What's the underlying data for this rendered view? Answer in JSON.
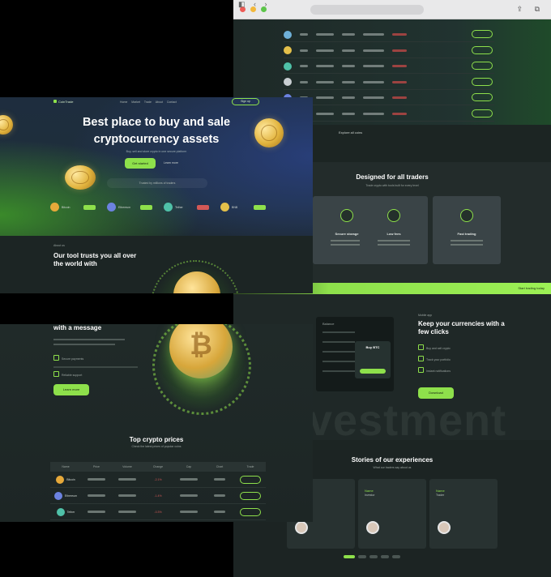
{
  "colors": {
    "accent": "#8ee04b",
    "bg_dark": "#1c2523",
    "negative": "#d35856"
  },
  "browser": {
    "traffic_lights": [
      "#ee5b56",
      "#f2b83b",
      "#5dc54a"
    ],
    "icons": [
      "back-icon",
      "forward-icon",
      "reload-icon",
      "share-icon",
      "tabs-icon"
    ]
  },
  "market": {
    "row_icons": [
      "#6fb0d8",
      "#e4c04a",
      "#4fc1a8",
      "#c9ced2",
      "#6c82e0",
      "#8e6fd8"
    ],
    "see_all": "Explore all coins"
  },
  "designed": {
    "title": "Designed for all traders",
    "subtitle": "Trade crypto with tools built for every level",
    "cards": [
      {
        "title": "Secure storage"
      },
      {
        "title": "Low fees"
      },
      {
        "title": "Fast trading"
      }
    ]
  },
  "banner": {
    "text": "Start trading today"
  },
  "keep": {
    "eyebrow": "Mobile app",
    "title": "Keep your currencies with a few clicks",
    "items": [
      "Buy and sell crypto",
      "Track your portfolio",
      "Instant notifications"
    ],
    "cta": "Download",
    "phone_header": "Balance",
    "popup_title": "Buy BTC"
  },
  "watermark": "vestment",
  "stories": {
    "title": "Stories of our experiences",
    "subtitle": "What our traders say about us",
    "cards": [
      {
        "name": "Name",
        "role": "Trader"
      },
      {
        "name": "Name",
        "role": "Investor"
      },
      {
        "name": "Name",
        "role": "Trader"
      }
    ]
  },
  "hero": {
    "nav_logo": "CoinTrade",
    "nav_links": "Home Market Trade About Contact",
    "nav_button": "Sign up",
    "title": "Best place to buy and sale cryptocurrency assets",
    "subtitle": "Buy, sell and store crypto in one secure platform",
    "cta": "Get started",
    "link": "Learn more",
    "trust": "Trusted by millions of traders",
    "tickers": [
      {
        "name": "Bitcoin",
        "color": "#e7a93a",
        "pill": "#8ee04b"
      },
      {
        "name": "Ethereum",
        "color": "#6c82e0",
        "pill": "#8ee04b"
      },
      {
        "name": "Tether",
        "color": "#4fc1a8",
        "pill": "#d35856"
      },
      {
        "name": "BNB",
        "color": "#e4c04a",
        "pill": "#8ee04b"
      }
    ],
    "lower_eyebrow": "About us",
    "lower_title": "Our tool trusts you all over the world with"
  },
  "card2": {
    "head": "with a message",
    "checks": [
      "Secure payments",
      "Reliable support"
    ],
    "cta": "Learn more",
    "coin_symbol": "₿"
  },
  "top_prices": {
    "title": "Top crypto prices",
    "subtitle": "Check the latest prices of popular coins",
    "headers": [
      "Name",
      "Price",
      "Volume",
      "Change",
      "Cap",
      "Chart",
      "Trade"
    ],
    "rows": [
      {
        "coin": "Bitcoin",
        "color": "#e7a93a",
        "change": "-2.1%"
      },
      {
        "coin": "Ethereum",
        "color": "#6c82e0",
        "change": "-1.4%"
      },
      {
        "coin": "Tether",
        "color": "#4fc1a8",
        "change": "-0.3%"
      }
    ]
  }
}
